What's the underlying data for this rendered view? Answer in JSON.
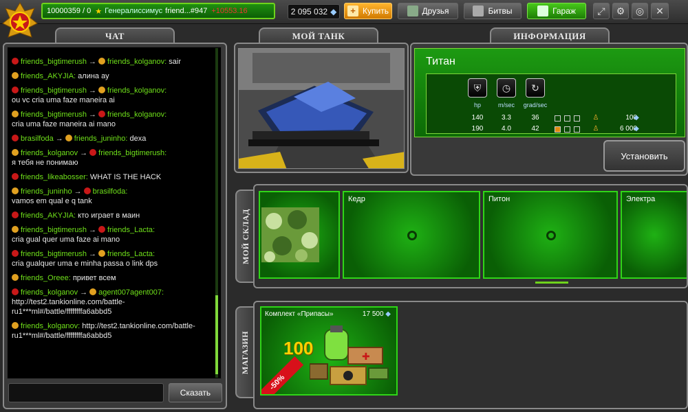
{
  "top": {
    "player_id": "10000359 / 0",
    "rank_title": "Генералиссимус",
    "player_name": "friend...",
    "player_tag": "#947",
    "score": "+10553.16",
    "crystals": "2 095 032",
    "buy_label": "Купить",
    "friends_label": "Друзья",
    "battles_label": "Битвы",
    "garage_label": "Гараж"
  },
  "panels": {
    "chat_title": "ЧАТ",
    "tank_title": "МОЙ ТАНК",
    "info_title": "ИНФОРМАЦИЯ",
    "warehouse_title": "МОЙ СКЛАД",
    "shop_title": "МАГАЗИН"
  },
  "chat": {
    "messages": [
      {
        "from": "friends_bigtimerush",
        "to": "friends_kolganov",
        "text": "sair",
        "inline": true
      },
      {
        "from": "friends_AKYJIA",
        "to": "",
        "text": "алина ау",
        "inline": true
      },
      {
        "from": "friends_bigtimerush",
        "to": "friends_kolganov",
        "text": "ou vc cria uma faze maneira ai",
        "inline": false
      },
      {
        "from": "friends_bigtimerush",
        "to": "friends_kolganov",
        "text": "cria uma faze maneira ai mano",
        "inline": false
      },
      {
        "from": "brasilfoda",
        "to": "friends_juninho",
        "text": "dexa",
        "inline": true
      },
      {
        "from": "friends_kolganov",
        "to": "friends_bigtimerush",
        "text": "я тебя не понимаю",
        "inline": false
      },
      {
        "from": "friends_likeabosser",
        "to": "",
        "text": "WHAT IS THE HACK",
        "inline": true
      },
      {
        "from": "friends_juninho",
        "to": "brasilfoda",
        "text": "vamos em qual e q tank",
        "inline": false
      },
      {
        "from": "friends_AKYJIA",
        "to": "",
        "text": "кто играет в маин",
        "inline": true
      },
      {
        "from": "friends_bigtimerush",
        "to": "friends_Lacta",
        "text": "cria gual quer uma faze ai mano",
        "inline": false
      },
      {
        "from": "friends_bigtimerush",
        "to": "friends_Lacta",
        "text": "cria gualquer uma e minha passa o link dps",
        "inline": false
      },
      {
        "from": "friends_Oreee",
        "to": "",
        "text": "привет всем",
        "inline": true
      },
      {
        "from": "friends_kolganov",
        "to": "agent007agent007",
        "text": "http://test2.tankionline.com/battle-ru1***ml#/battle/ffffffffa6abbd5",
        "inline": false
      },
      {
        "from": "friends_kolganov",
        "to": "",
        "text": "http://test2.tankionline.com/battle-ru1***ml#/battle/ffffffffa6abbd5",
        "inline": true
      }
    ],
    "send_label": "Сказать"
  },
  "info": {
    "tank_name": "Титан",
    "param_labels": [
      "hp",
      "m/sec",
      "grad/sec"
    ],
    "rows": [
      {
        "hp": "140",
        "speed": "3.3",
        "turn": "36",
        "price": "100"
      },
      {
        "hp": "190",
        "speed": "4.0",
        "turn": "42",
        "price": "6 000"
      }
    ],
    "install_label": "Установить"
  },
  "warehouse": {
    "items": [
      "",
      "Кедр",
      "Питон",
      "Электра"
    ]
  },
  "shop": {
    "item_name": "Комплект «Припасы»",
    "price": "17 500",
    "quantity": "100",
    "discount": "-50%"
  },
  "colors": {
    "accent_green": "#2fd617",
    "chat_name": "#6fe01a",
    "buy_orange": "#ffb52e"
  }
}
